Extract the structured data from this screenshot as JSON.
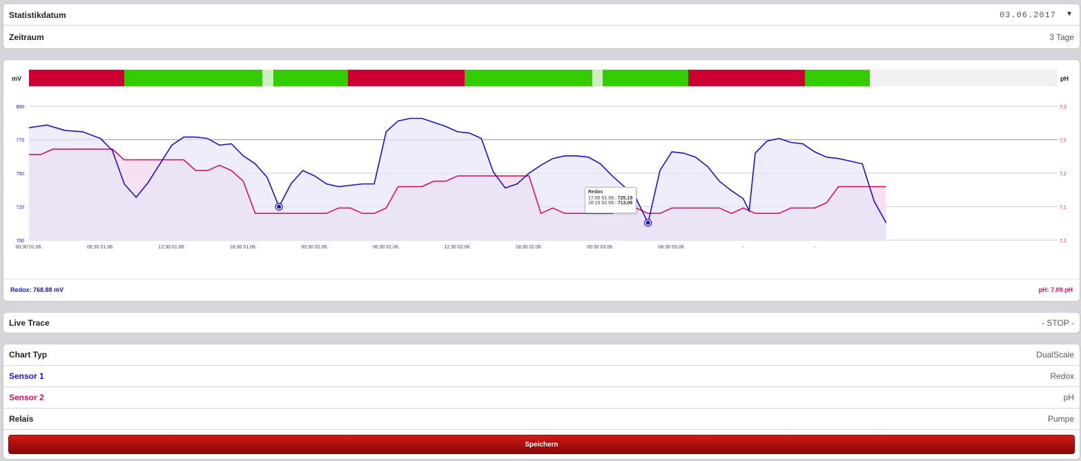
{
  "stat": {
    "date_label": "Statistikdatum",
    "date_value": "03.06.2017",
    "period_label": "Zeitraum",
    "period_value": "3 Tage"
  },
  "chart": {
    "left_unit": "mV",
    "right_unit": "pH",
    "tooltip": {
      "title": "Redox",
      "line1_time": "17:00 01.06.:",
      "line1_value": "725,19",
      "line2_time": "16:15 02.06.:",
      "line2_value": "713,06"
    },
    "footer_left": "Redox: 768.88 mV",
    "footer_right": "pH: 7.09 pH"
  },
  "chart_data": {
    "type": "line",
    "x_tick_labels": [
      "00:30 01.06.",
      "06:30 01.06.",
      "12:30 01.06.",
      "18:30 01.06.",
      "00:30 02.06.",
      "06:30 02.06.",
      "12:30 02.06.",
      "18:30 02.06.",
      "00:30 03.06.",
      "06:30 03.06.",
      "-",
      "-"
    ],
    "y_left_ticks": [
      "800",
      "775",
      "750",
      "725",
      "700"
    ],
    "y_right_ticks": [
      "7,3",
      "7,2",
      "7,2",
      "7,1",
      "7,1"
    ],
    "y_left_range": [
      700,
      800
    ],
    "y_right_range": [
      7.05,
      7.3
    ],
    "x_range_hours": [
      0,
      72
    ],
    "grid": true,
    "series": [
      {
        "name": "Redox",
        "axis": "left",
        "color": "#1a10c8",
        "fill": "#e6e6fa",
        "x_hours": [
          0,
          1.5,
          3,
          4.5,
          6,
          7,
          8,
          9,
          10,
          11,
          12,
          13,
          14,
          15,
          16,
          17,
          18,
          19,
          20,
          21,
          22,
          23,
          24,
          25,
          26,
          27,
          28,
          29,
          30,
          31,
          32,
          33,
          34,
          35,
          36,
          37,
          38,
          39,
          40,
          41,
          42,
          43,
          44,
          45,
          46,
          47,
          48,
          49,
          50,
          51,
          52,
          53,
          54,
          55,
          56,
          57,
          58,
          59,
          60,
          60.5
        ],
        "values": [
          784,
          786,
          782,
          781,
          776,
          767,
          742,
          732,
          743,
          757,
          771,
          777,
          777,
          776,
          771,
          772,
          763,
          757,
          747,
          725,
          742,
          752,
          748,
          742,
          740,
          741,
          742,
          742,
          781,
          789,
          791,
          791,
          788,
          785,
          781,
          780,
          776,
          751,
          739,
          742,
          750,
          756,
          761,
          763,
          763,
          762,
          757,
          748,
          740,
          731,
          713,
          752,
          766,
          765,
          762,
          755,
          744,
          737,
          731,
          722
        ],
        "x_hours_2": [
          60.5,
          61,
          62,
          63,
          64,
          65,
          66,
          67,
          68,
          69,
          70,
          71,
          72
        ],
        "values_2": [
          722,
          765,
          774,
          776,
          773,
          772,
          766,
          762,
          761,
          759,
          757,
          729,
          713
        ]
      },
      {
        "name": "pH",
        "axis": "right",
        "color": "#d81060",
        "fill": "#f6dcef",
        "x_hours": [
          0,
          1,
          2,
          3,
          4,
          5,
          6,
          7,
          8,
          9,
          10,
          11,
          12,
          13,
          14,
          15,
          16,
          17,
          18,
          19,
          20,
          21,
          22,
          23,
          24,
          25,
          26,
          27,
          28,
          29,
          30,
          31,
          32,
          33,
          34,
          35,
          36,
          37,
          38,
          39,
          40,
          41,
          42,
          43,
          44,
          45,
          46,
          47,
          48,
          49,
          50,
          51,
          52,
          53,
          54,
          55,
          56,
          57,
          58,
          59,
          60,
          61,
          62,
          63,
          64,
          65,
          66,
          67,
          68,
          69,
          70,
          71,
          72
        ],
        "values": [
          7.21,
          7.21,
          7.22,
          7.22,
          7.22,
          7.22,
          7.22,
          7.22,
          7.2,
          7.2,
          7.2,
          7.2,
          7.2,
          7.2,
          7.18,
          7.18,
          7.19,
          7.18,
          7.16,
          7.1,
          7.1,
          7.1,
          7.1,
          7.1,
          7.1,
          7.1,
          7.11,
          7.11,
          7.1,
          7.1,
          7.11,
          7.15,
          7.15,
          7.15,
          7.16,
          7.16,
          7.17,
          7.17,
          7.17,
          7.17,
          7.17,
          7.17,
          7.17,
          7.1,
          7.11,
          7.1,
          7.1,
          7.1,
          7.1,
          7.1,
          7.11,
          7.11,
          7.1,
          7.1,
          7.11,
          7.11,
          7.11,
          7.11,
          7.11,
          7.1,
          7.11,
          7.1,
          7.1,
          7.1,
          7.11,
          7.11,
          7.11,
          7.12,
          7.15,
          7.15,
          7.15,
          7.15,
          7.15
        ]
      }
    ]
  },
  "relay_bar": {
    "hours_total": 86.4,
    "segments": [
      {
        "from": 0,
        "to": 8,
        "state": "on",
        "color": "#cc0033"
      },
      {
        "from": 8,
        "to": 19.6,
        "state": "off",
        "color": "#33cc00"
      },
      {
        "from": 19.6,
        "to": 20.5,
        "state": "gap",
        "color": "#cdeec0"
      },
      {
        "from": 20.5,
        "to": 26.8,
        "state": "off",
        "color": "#33cc00"
      },
      {
        "from": 26.8,
        "to": 36.6,
        "state": "on",
        "color": "#cc0033"
      },
      {
        "from": 36.6,
        "to": 47.3,
        "state": "off",
        "color": "#33cc00"
      },
      {
        "from": 47.3,
        "to": 48.2,
        "state": "gap",
        "color": "#cdeec0"
      },
      {
        "from": 48.2,
        "to": 55.4,
        "state": "off",
        "color": "#33cc00"
      },
      {
        "from": 55.4,
        "to": 65.2,
        "state": "on",
        "color": "#cc0033"
      },
      {
        "from": 65.2,
        "to": 70.6,
        "state": "off",
        "color": "#33cc00"
      }
    ]
  },
  "live": {
    "label": "Live Trace",
    "value": "- STOP -"
  },
  "settings": {
    "chart_type_label": "Chart Typ",
    "chart_type_value": "DualScale",
    "sensor1_label": "Sensor 1",
    "sensor1_value": "Redox",
    "sensor2_label": "Sensor 2",
    "sensor2_value": "pH",
    "relay_label": "Relais",
    "relay_value": "Pumpe",
    "save_label": "Speichern"
  },
  "colors": {
    "sensor1": "#1a10c8",
    "sensor2": "#d81060"
  }
}
